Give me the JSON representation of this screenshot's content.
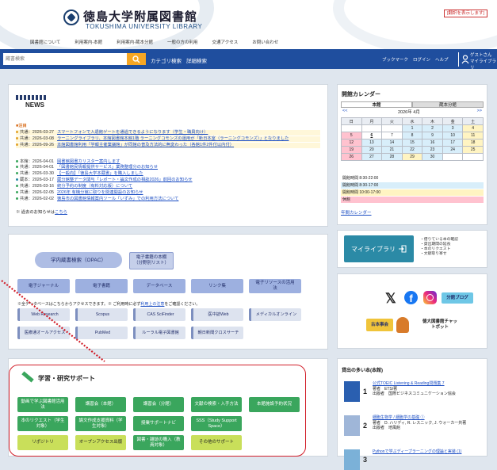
{
  "header": {
    "title": "徳島大学附属図書館",
    "subtitle": "TOKUSHIMA UNIVERSITY LIBRARY",
    "lang_button": "[翻訳を表示します]",
    "nav": [
      "図書館について",
      "利用案内-本館",
      "利用案内-蔵本分館",
      "一般の方の利用",
      "交通アクセス",
      "お問い合わせ"
    ]
  },
  "search": {
    "placeholder": "蔵書検索",
    "links": [
      "カテゴリ検索",
      "詳細検索"
    ],
    "right_links": [
      "ブックマーク",
      "ログイン",
      "ヘルプ"
    ],
    "mylibrary": [
      "ゲストさん",
      "マイライブラリ"
    ]
  },
  "news": {
    "label": "NEWS",
    "section_label": "■注目",
    "items": [
      {
        "date": "共通：2026-03-27",
        "text": "スマートフォンで入退館ゲートを通過できるようになります（学生・職員向け）",
        "hl": true
      },
      {
        "date": "共通：2026-03-08",
        "text": "ラーニングライブラリ、本館図書館本館1階 ラーニングコモンズの運用が「新日本室（ラーニングコモンズ）」となりました",
        "hl": true
      },
      {
        "date": "共通：2026-09-26",
        "text": "本館図書館利用「学報主催業議館」が同館の普及方法的に無変わった（各館1件2件付以内付）",
        "hl": true
      },
      {
        "date": "本館：2026-04-01",
        "text": "図書館図書カリスター案内します",
        "hl": false
      },
      {
        "date": "共通：2026-04-01",
        "text": "「図書館民情報提供サービス」業務整理分のお知らせ",
        "hl": false
      },
      {
        "date": "共通：2026-03-30",
        "text": "【一般向】「徳島大学本蔵書」を購入しました",
        "hl": false
      },
      {
        "date": "蔵本：2026-03-17",
        "text": "蔵分館整データ関与「レポート・論文作成の相談2026」前回のお知らせ",
        "hl": false
      },
      {
        "date": "共通：2026-03-16",
        "text": "統分予約の制度（有料対応版）について",
        "hl": false
      },
      {
        "date": "共通：2026-02-05",
        "text": "2026年 有機分館に取りを関連開設のお知らせ",
        "hl": false
      },
      {
        "date": "共通：2026-02-02",
        "text": "徳島市の図書館情報案内ツール「いずみ」での利用方法について",
        "hl": false
      }
    ],
    "past": "※ 過去のお知らせは",
    "past_link": "こちら"
  },
  "calendar": {
    "title": "開館カレンダー",
    "tabs": [
      "本館",
      "蔵本分館"
    ],
    "prev": "<<",
    "month": "2026年 4月",
    "next": ">>",
    "days": [
      "日",
      "月",
      "火",
      "水",
      "木",
      "金",
      "土"
    ],
    "weeks": [
      [
        "",
        "",
        "",
        "1",
        "2",
        "3",
        "4"
      ],
      [
        "5",
        "6",
        "7",
        "8",
        "9",
        "10",
        "11"
      ],
      [
        "12",
        "13",
        "14",
        "15",
        "16",
        "17",
        "18"
      ],
      [
        "19",
        "20",
        "21",
        "22",
        "23",
        "24",
        "25"
      ],
      [
        "26",
        "27",
        "28",
        "29",
        "30",
        "",
        ""
      ]
    ],
    "hours": [
      {
        "text": "開館時間 8:30-22:00",
        "color": "#ffffff"
      },
      {
        "text": "開館時間 8:30-17:00",
        "color": "#d8eefa"
      },
      {
        "text": "開館時間 10:00-17:00",
        "color": "#fff4c2"
      },
      {
        "text": "休館",
        "color": "#ffc2cf"
      }
    ],
    "more": "年間カレンダー",
    "colors": {
      "holiday": "#ffc2cf",
      "short": "#d8eefa",
      "weekend": "#fff4c2",
      "today": "#ffffff"
    }
  },
  "resources": {
    "opac": "学内蔵書検索（OPAC）",
    "ebook_list": "電子書籍の本棚（分野別リスト）",
    "eres": [
      "電子ジャーナル",
      "電子書籍",
      "データベース",
      "リンク集",
      "電子リソースの活用法"
    ],
    "note": "※全データベースはこちらからアクセスできます。※ ご利用時に必ず",
    "note_link": "利用上の注意",
    "note_tail": "をご確認ください。",
    "dbs": [
      "Web Research",
      "Scopus",
      "CAS SciFinder",
      "医中誌Web",
      "メディカルオンライン",
      "医療通オールアクセス",
      "PubMed",
      "ルーラル電子図書館",
      "朝日新聞クロスサーチ"
    ]
  },
  "side": {
    "mylibrary_btn": "マイライブラリ",
    "mylibrary_items": [
      "・借りている本の確認",
      "・貸出期間の延長",
      "・本のリクエスト",
      "・文献取り寄せ"
    ],
    "blog": "分館ブログ",
    "book_club": "古本事会",
    "chatbot": "徳大図書館チャットボット"
  },
  "study": {
    "title": "学習・研究サポート",
    "buttons": [
      "動画で学ぶ図書館活用法",
      "講習会（本館）",
      "講習会（分館）",
      "文献の検索・入手方法",
      "本館施設予約状況",
      "本のリクエスト（学生対象）",
      "論文作成支援資料（学生対象）",
      "授業サポートナビ",
      "SSS（Study Support Space）",
      "",
      "リポジトリ",
      "オープンアクセス出版",
      "図書・雑誌の購入（教員対象）",
      "その他のサポート",
      ""
    ]
  },
  "ranking": {
    "title": "貸出の多い本(本館)",
    "items": [
      {
        "rank": "1",
        "title": "公式TOEIC Listening & Reading問題集 7",
        "author": "著者　ETS/著",
        "publisher": "出版者　国際ビジネスコミュニケーション協会"
      },
      {
        "rank": "2",
        "title": "細胞生物学 / 細胞学の基礎 ①",
        "author": "著者　D. ハリディ, R. レスニック, J. ウォーカー共著",
        "publisher": "出版者　培風館"
      },
      {
        "rank": "3",
        "title": "Pythonで学ぶディープラーニングの理論と実装 (1)",
        "author": "",
        "publisher": ""
      }
    ]
  }
}
